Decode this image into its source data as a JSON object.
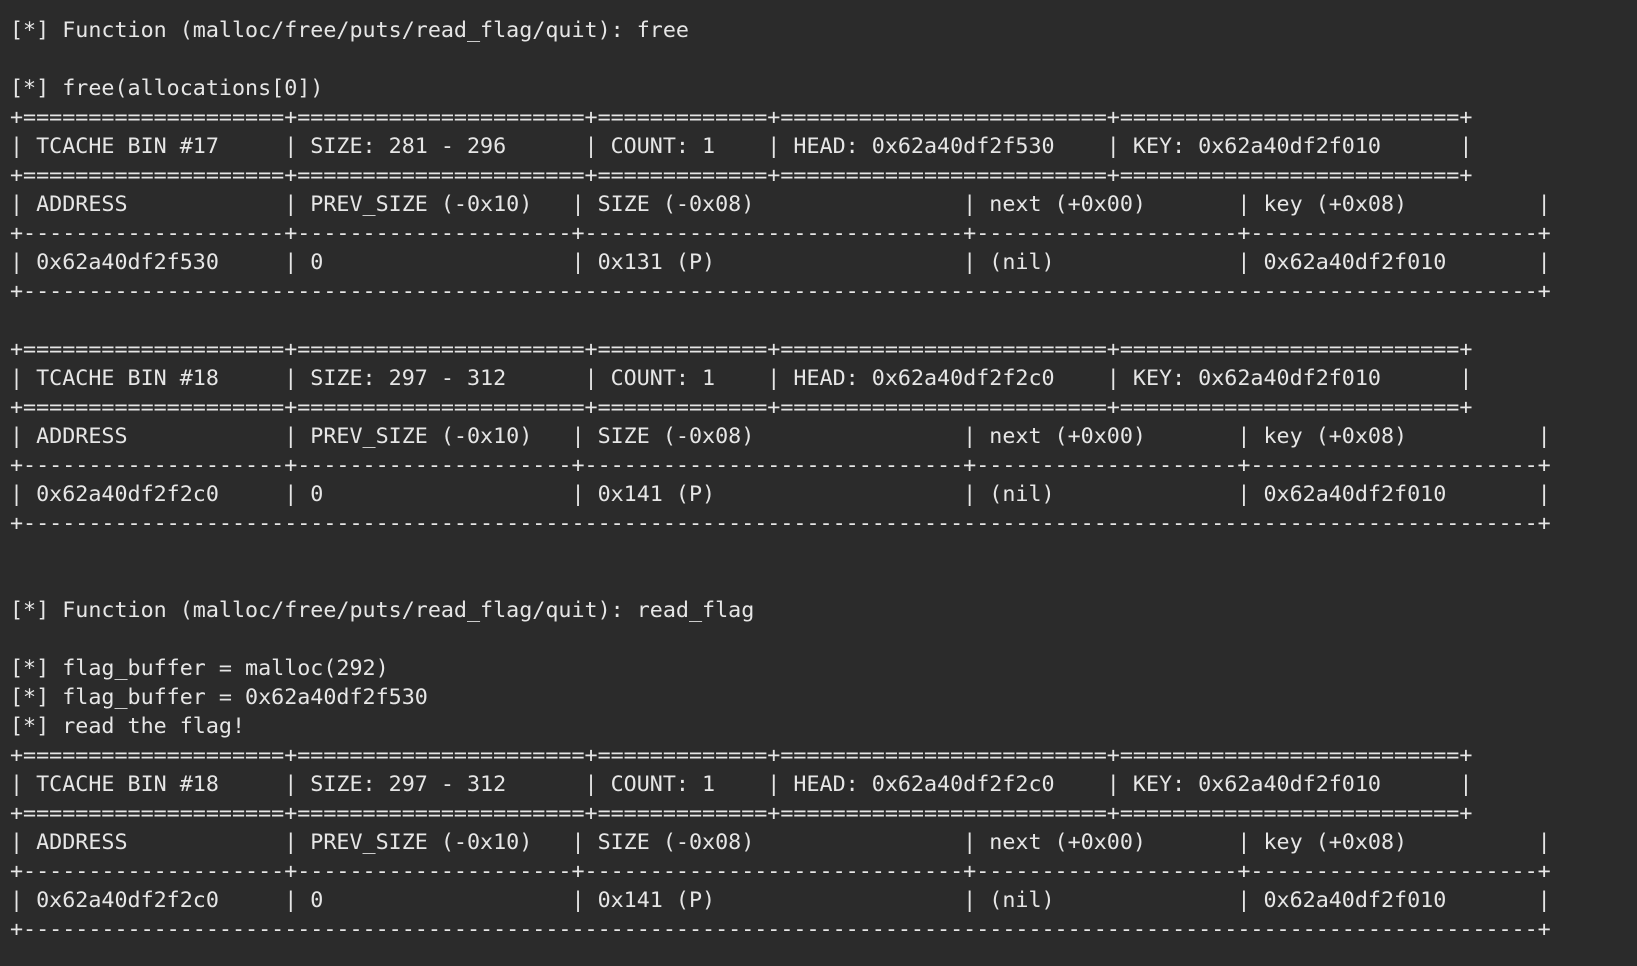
{
  "terminal": {
    "lines": [
      "[*] Function (malloc/free/puts/read_flag/quit): free",
      "",
      "[*] free(allocations[0])",
      "+====================+======================+=============+=========================+==========================+",
      "| TCACHE BIN #17     | SIZE: 281 - 296      | COUNT: 1    | HEAD: 0x62a40df2f530    | KEY: 0x62a40df2f010      |",
      "+====================+======================+=============+=========================+==========================+",
      "| ADDRESS            | PREV_SIZE (-0x10)   | SIZE (-0x08)                | next (+0x00)       | key (+0x08)          |",
      "+--------------------+---------------------+-----------------------------+--------------------+----------------------+",
      "| 0x62a40df2f530     | 0                   | 0x131 (P)                   | (nil)              | 0x62a40df2f010       |",
      "+--------------------------------------------------------------------------------------------------------------------+",
      "",
      "+====================+======================+=============+=========================+==========================+",
      "| TCACHE BIN #18     | SIZE: 297 - 312      | COUNT: 1    | HEAD: 0x62a40df2f2c0    | KEY: 0x62a40df2f010      |",
      "+====================+======================+=============+=========================+==========================+",
      "| ADDRESS            | PREV_SIZE (-0x10)   | SIZE (-0x08)                | next (+0x00)       | key (+0x08)          |",
      "+--------------------+---------------------+-----------------------------+--------------------+----------------------+",
      "| 0x62a40df2f2c0     | 0                   | 0x141 (P)                   | (nil)              | 0x62a40df2f010       |",
      "+--------------------------------------------------------------------------------------------------------------------+",
      "",
      "",
      "[*] Function (malloc/free/puts/read_flag/quit): read_flag",
      "",
      "[*] flag_buffer = malloc(292)",
      "[*] flag_buffer = 0x62a40df2f530",
      "[*] read the flag!",
      "+====================+======================+=============+=========================+==========================+",
      "| TCACHE BIN #18     | SIZE: 297 - 312      | COUNT: 1    | HEAD: 0x62a40df2f2c0    | KEY: 0x62a40df2f010      |",
      "+====================+======================+=============+=========================+==========================+",
      "| ADDRESS            | PREV_SIZE (-0x10)   | SIZE (-0x08)                | next (+0x00)       | key (+0x08)          |",
      "+--------------------+---------------------+-----------------------------+--------------------+----------------------+",
      "| 0x62a40df2f2c0     | 0                   | 0x141 (P)                   | (nil)              | 0x62a40df2f010       |",
      "+--------------------------------------------------------------------------------------------------------------------+"
    ]
  }
}
